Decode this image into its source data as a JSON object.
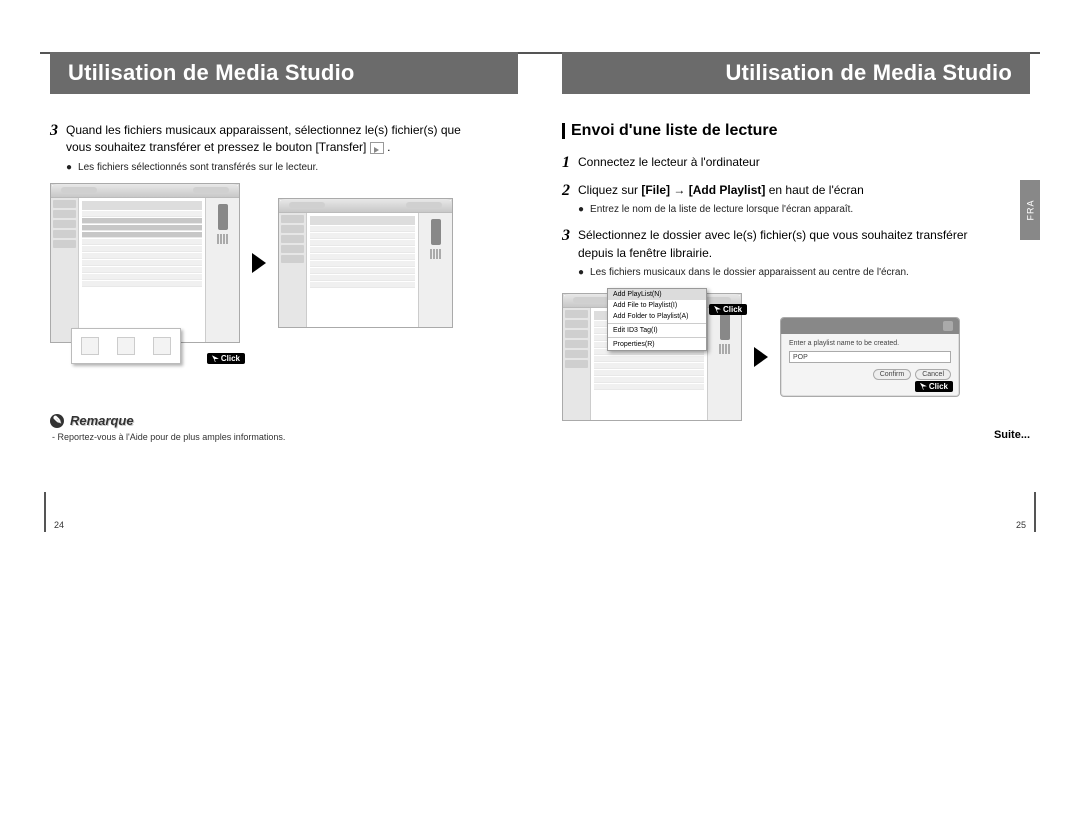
{
  "left": {
    "title": "Utilisation de Media Studio",
    "step3_num": "3",
    "step3_line1": "Quand les fichiers musicaux apparaissent, sélectionnez le(s) fichier(s) que",
    "step3_line2_pre": "vous souhaitez transférer et pressez le bouton [Transfer] ",
    "step3_line2_post": " .",
    "bullet1": "Les fichiers sélectionnés sont transférés sur le lecteur.",
    "remarque_label": "Remarque",
    "remarque_text": "- Reportez-vous à l'Aide pour de plus amples informations.",
    "page_num": "24",
    "click_label": "Click"
  },
  "right": {
    "title": "Utilisation de Media Studio",
    "section": "Envoi d'une liste de lecture",
    "step1_num": "1",
    "step1_text": "Connectez le lecteur à l'ordinateur",
    "step2_num": "2",
    "step2_pre": "Cliquez sur ",
    "step2_b1": "[File]",
    "step2_arrow": " → ",
    "step2_b2": "[Add Playlist]",
    "step2_post": " en haut de l'écran",
    "step2_bullet": "Entrez le nom de la liste de lecture lorsque l'écran apparaît.",
    "step3_num": "3",
    "step3_line1": "Sélectionnez le dossier avec le(s) fichier(s) que vous souhaitez transférer",
    "step3_line2": "depuis la fenêtre librairie.",
    "step3_bullet": "Les fichiers musicaux dans le dossier apparaissent au centre de l'écran.",
    "menu_items": [
      "Add PlayList(N)",
      "Add File to Playlist(I)",
      "Add Folder to Playlist(A)",
      "Edit ID3 Tag(I)",
      "Properties(R)"
    ],
    "dlg_prompt": "Enter a playlist name to be created.",
    "dlg_input": "POP",
    "dlg_confirm": "Confirm",
    "dlg_cancel": "Cancel",
    "suite": "Suite...",
    "side_tab": "FRA",
    "page_num": "25",
    "click_label": "Click"
  }
}
